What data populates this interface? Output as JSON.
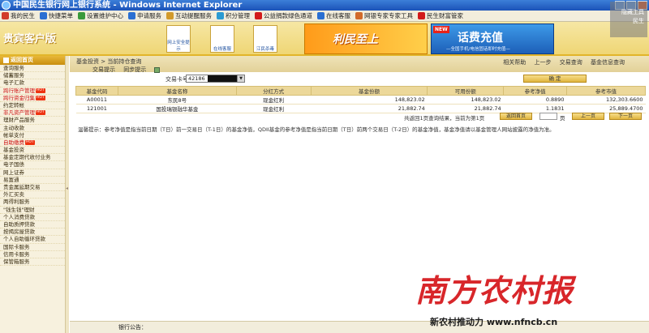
{
  "window": {
    "title": "中国民生银行网上银行系统 - Windows Internet Explorer"
  },
  "links_bar": {
    "items": [
      {
        "label": "我的民生",
        "icon": "house-icon",
        "color": "#d23b2a"
      },
      {
        "label": "快捷菜单",
        "icon": "menu-icon",
        "color": "#2a6fd2"
      },
      {
        "label": "设置维护中心",
        "icon": "gear-icon",
        "color": "#3a9a3a"
      },
      {
        "label": "申请服务",
        "icon": "form-icon",
        "color": "#2a6fd2"
      },
      {
        "label": "互动提醒服务",
        "icon": "bell-icon",
        "color": "#d29a2a"
      },
      {
        "label": "积分管理",
        "icon": "star-icon",
        "color": "#2a9ad2"
      },
      {
        "label": "公益捐款绿色通道",
        "icon": "cross-icon",
        "color": "#d21a1a"
      },
      {
        "label": "在线客服",
        "icon": "chat-icon",
        "color": "#2a6fd2"
      },
      {
        "label": "网银专家专家工具",
        "icon": "tool-icon",
        "color": "#d26a2a"
      },
      {
        "label": "民生财富管家",
        "icon": "coin-icon",
        "color": "#d21a1a"
      }
    ],
    "hidden_overlay": "隐藏工具\n民生"
  },
  "banner": {
    "vip_label": "贵宾客户版",
    "icons": [
      {
        "caption": "网上安全提示"
      },
      {
        "caption": "在线客服"
      },
      {
        "caption": "江民杀毒"
      }
    ],
    "ad1": "利民至上",
    "ad2": {
      "new_badge": "NEW",
      "title": "话费充值",
      "subtitle": "—全国手机/电信固话即时充值—"
    }
  },
  "sidebar": {
    "home": "返回首页",
    "items": [
      {
        "label": "查询服务",
        "hot": false,
        "highlight": false
      },
      {
        "label": "储蓄服务",
        "hot": false,
        "highlight": false
      },
      {
        "label": "电子汇款",
        "hot": false,
        "highlight": false
      },
      {
        "label": "跨行账户管理",
        "hot": true,
        "highlight": true
      },
      {
        "label": "跨行资金归集",
        "hot": true,
        "highlight": true
      },
      {
        "label": "约定转帐",
        "hot": false,
        "highlight": false
      },
      {
        "label": "非凡资产管理",
        "hot": true,
        "highlight": true
      },
      {
        "label": "理财产品服务",
        "hot": false,
        "highlight": false
      },
      {
        "label": "主动收款",
        "hot": false,
        "highlight": false
      },
      {
        "label": "帐单支付",
        "hot": false,
        "highlight": false
      },
      {
        "label": "自助缴费",
        "hot": true,
        "highlight": true
      },
      {
        "label": "基金投资",
        "hot": false,
        "highlight": false
      },
      {
        "label": "基金定期代收付业务",
        "hot": false,
        "highlight": false
      },
      {
        "label": "电子国债",
        "hot": false,
        "highlight": false
      },
      {
        "label": "网上证券",
        "hot": false,
        "highlight": false
      },
      {
        "label": "易富通",
        "hot": false,
        "highlight": false
      },
      {
        "label": "贵金属延期交易",
        "hot": false,
        "highlight": false
      },
      {
        "label": "外汇买卖",
        "hot": false,
        "highlight": false
      },
      {
        "label": "两得利服务",
        "hot": false,
        "highlight": false
      },
      {
        "label": "\"钱生钱\"理财",
        "hot": false,
        "highlight": false
      },
      {
        "label": "个人消费贷款",
        "hot": false,
        "highlight": false
      },
      {
        "label": "自助质押贷款",
        "hot": false,
        "highlight": false
      },
      {
        "label": "按揭房屋贷款",
        "hot": false,
        "highlight": false
      },
      {
        "label": "个人自助循环贷款",
        "hot": false,
        "highlight": false
      },
      {
        "label": "国际卡服务",
        "hot": false,
        "highlight": false
      },
      {
        "label": "信用卡服务",
        "hot": false,
        "highlight": false
      },
      {
        "label": "保管箱服务",
        "hot": false,
        "highlight": false
      }
    ]
  },
  "main": {
    "breadcrumb": "基金投资 > 当前持仓查询",
    "sub_tabs": {
      "tab1": "交易提示",
      "tab2": "同步提示"
    },
    "right_links": [
      "相关帮助",
      "上一步",
      "交易查询",
      "基金信息查询"
    ],
    "form": {
      "card_label": "交易卡号",
      "card_value": "42186",
      "query_button": "确 定"
    },
    "table": {
      "headers": [
        "基金代码",
        "基金名称",
        "分红方式",
        "基金份额",
        "可用份额",
        "参考净值",
        "参考市值"
      ],
      "rows": [
        [
          "A00011",
          "东民8号",
          "现金红利",
          "148,823.02",
          "148,823.02",
          "0.8890",
          "132,303.6600"
        ],
        [
          "121001",
          "国投瑞银融华基金",
          "现金红利",
          "21,882.74",
          "21,882.74",
          "1.1831",
          "25,889.4700"
        ]
      ]
    },
    "pager": {
      "summary": "共返回1页查询结果，当前为第1页",
      "first_button": "返回首页",
      "page_unit": "页",
      "prev_button": "上一页",
      "next_button": "下一页"
    },
    "notice": "温馨提示：参考净值是指当前日期（T日）前一交易日（T-1日）的基金净值，QDII基金的参考净值是指当前日期（T日）前两个交易日（T-2日）的基金净值，基金净值请以基金管理人网站披露的净值为准。"
  },
  "status": {
    "bank_notice": "银行公告："
  },
  "watermark": {
    "big": "南方农村报",
    "small": "新农村推动力  www.nfncb.cn"
  }
}
